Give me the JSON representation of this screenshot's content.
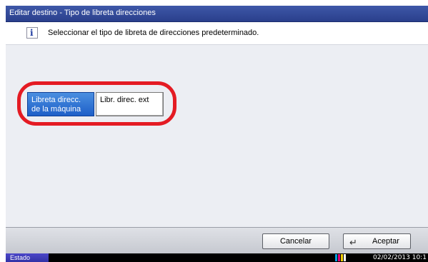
{
  "window": {
    "title": "Editar destino - Tipo de libreta direcciones"
  },
  "info": {
    "text": "Seleccionar el tipo de libreta de direcciones predeterminado."
  },
  "options": {
    "machine_line1": "Libreta direcc.",
    "machine_line2": "de la máquina",
    "external": "Libr. direc. ext"
  },
  "footer": {
    "cancel_label": "Cancelar",
    "accept_label": "Aceptar"
  },
  "status": {
    "label": "Estado",
    "datetime": "02/02/2013  10:1"
  },
  "colors": {
    "title_bar": "#2f4a99",
    "selected": "#2a6fd6",
    "highlight": "#e41b23"
  },
  "icons": {
    "info": "info-icon",
    "enter": "enter-icon",
    "toner": "toner-icon"
  }
}
